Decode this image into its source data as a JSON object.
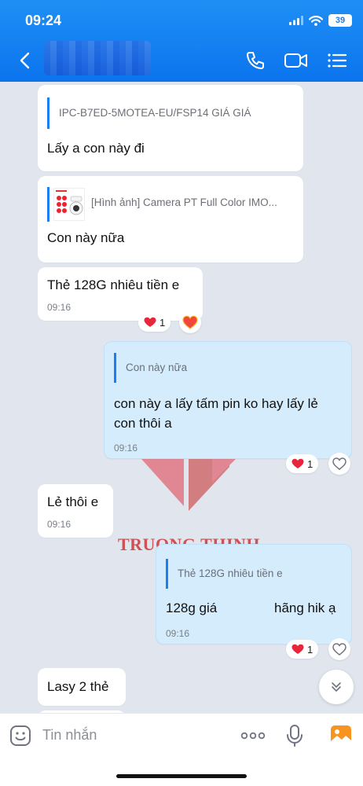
{
  "status_bar": {
    "time": "09:24",
    "battery": "39"
  },
  "header": {
    "contact_name": ""
  },
  "messages": [
    {
      "quote": "IPC-B7ED-5MOTEA-EU/FSP14 GIÁ GIÁ",
      "text": "Lấy a con này đi"
    },
    {
      "quote": "[Hình ảnh] Camera PT Full Color IMO...",
      "text": "Con này nữa"
    },
    {
      "text": "Thẻ 128G nhiêu tiền e",
      "time": "09:16",
      "reaction_count": "1"
    },
    {
      "quote": "Con này nữa",
      "text_line1": "con này a lấy tấm pin ko hay lấy lẻ",
      "text_line2": "con thôi a",
      "time": "09:16",
      "reaction_count": "1"
    },
    {
      "text": "Lẻ thôi e",
      "time": "09:16"
    },
    {
      "quote": "Thẻ 128G nhiêu tiền e",
      "text_a": "128g giá",
      "text_b": "hãng hik ạ",
      "time": "09:16",
      "reaction_count": "1"
    },
    {
      "text": "Lasy 2 thẻ"
    }
  ],
  "watermark": {
    "text": "TRUONG THINH"
  },
  "input": {
    "placeholder": "Tin nhắn"
  },
  "colors": {
    "header": "#0b74ee",
    "accent": "#1a7ff0",
    "heart": "#e8253b",
    "sent_bubble": "#d5ecfd",
    "background": "#e1e6ee"
  }
}
